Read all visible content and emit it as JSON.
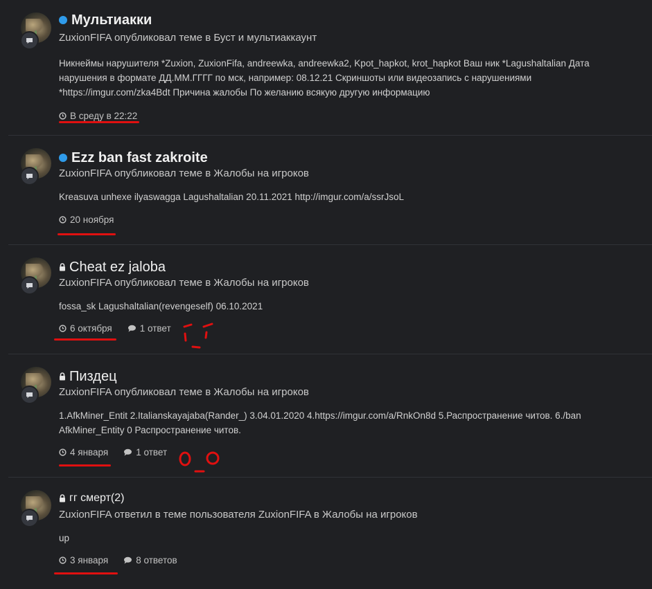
{
  "colors": {
    "background": "#1f2023",
    "divider": "#303237",
    "unread_dot": "#2f9bea",
    "annotation_red": "#e01010"
  },
  "icons": {
    "type_badge": "speech-bubble-icon",
    "clock": "clock-icon",
    "replies": "speech-bubble-icon",
    "lock": "lock-icon",
    "unread": "unread-dot-icon"
  },
  "items": [
    {
      "title": "Мультиакки",
      "unread": true,
      "locked": false,
      "meta": "ZuxionFIFA опубликовал теме в Буст и мультиаккаунт",
      "snippet": "Никнеймы нарушителя *Zuxion, ZuxionFifa, andreewka, andreewka2, Kpot_hapkot, krot_hapkot Ваш ник *Lagushaltalian Дата нарушения в формате ДД.ММ.ГГГГ по мск, например: 08.12.21 Скриншоты или видеозапись с нарушениями *https://imgur.com/zka4Bdt Причина жалобы По желанию всякую другую информацию",
      "date": "В среду в 22:22",
      "replies": ""
    },
    {
      "title": "Ezz ban fast zakroite",
      "unread": true,
      "locked": false,
      "meta": "ZuxionFIFA опубликовал теме в Жалобы на игроков",
      "snippet": "Kreasuva unhexe ilyaswagga Lagushaltalian 20.11.2021 http://imgur.com/a/ssrJsoL",
      "date": "20 ноября",
      "replies": ""
    },
    {
      "title": "Cheat ez jaloba",
      "unread": false,
      "locked": true,
      "meta": "ZuxionFIFA опубликовал теме в Жалобы на игроков",
      "snippet": "fossa_sk Lagushaltalian(revengeself) 06.10.2021",
      "date": "6 октября",
      "replies": "1 ответ"
    },
    {
      "title": "Пиздец",
      "unread": false,
      "locked": true,
      "meta": "ZuxionFIFA опубликовал теме в Жалобы на игроков",
      "snippet": "1.AfkMiner_Entit 2.Italianskayajaba(Rander_) 3.04.01.2020 4.https://imgur.com/a/RnkOn8d 5.Распространение читов. 6./ban AfkMiner_Entity 0 Распространение читов.",
      "date": "4 января",
      "replies": "1 ответ"
    },
    {
      "title": "гг смерт(2)",
      "unread": false,
      "locked": true,
      "meta": "ZuxionFIFA ответил в теме пользователя ZuxionFIFA в Жалобы на игроков",
      "snippet": "up",
      "date": "3 января",
      "replies": "8 ответов"
    }
  ]
}
